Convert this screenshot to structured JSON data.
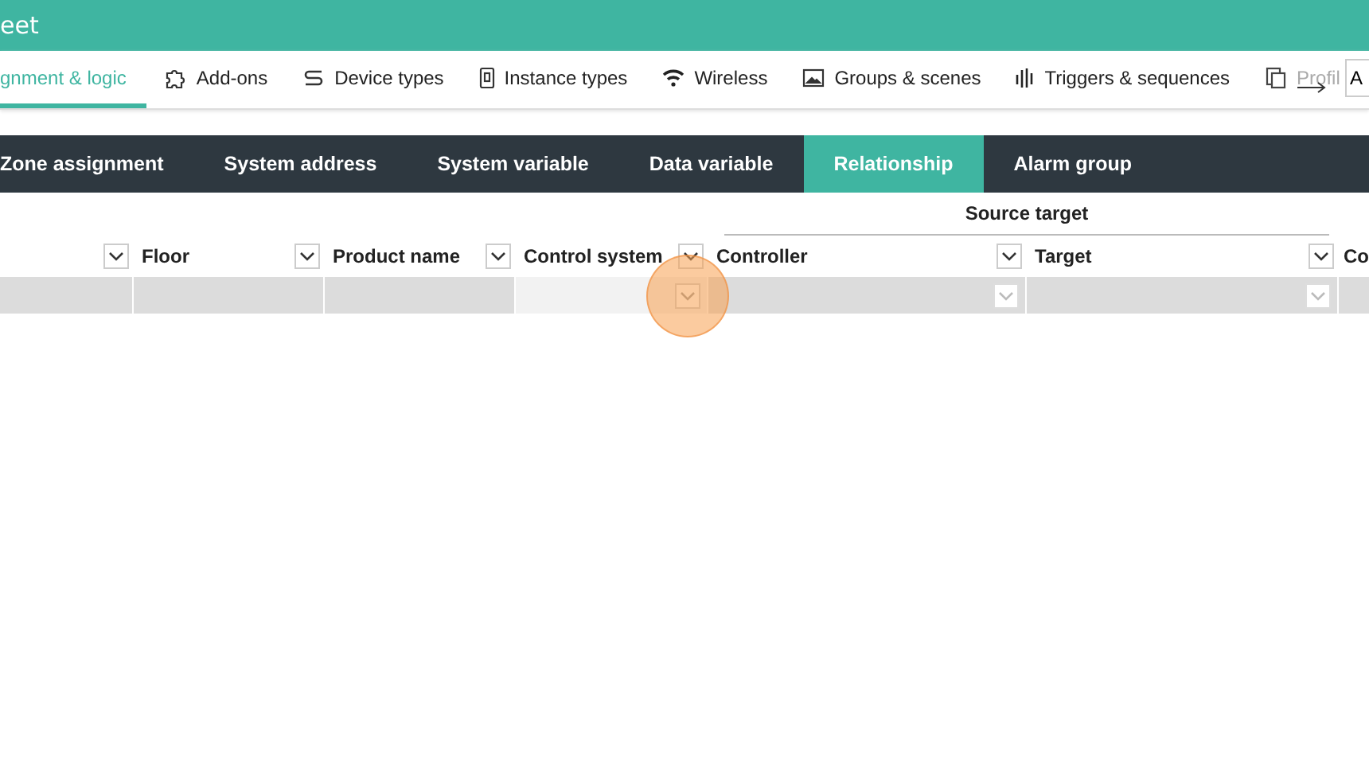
{
  "window": {
    "title": "eet"
  },
  "nav_tabs": [
    {
      "label": "gnment & logic",
      "selected": true,
      "kind": "plain"
    },
    {
      "label": "Add-ons",
      "selected": false,
      "kind": "puzzle"
    },
    {
      "label": "Device types",
      "selected": false,
      "kind": "device"
    },
    {
      "label": "Instance types",
      "selected": false,
      "kind": "phone"
    },
    {
      "label": "Wireless",
      "selected": false,
      "kind": "wifi"
    },
    {
      "label": "Groups & scenes",
      "selected": false,
      "kind": "picture"
    },
    {
      "label": "Triggers & sequences",
      "selected": false,
      "kind": "bars"
    },
    {
      "label": "Profil",
      "selected": false,
      "kind": "profile"
    }
  ],
  "nav_field": {
    "value": "A"
  },
  "sub_tabs": [
    {
      "label": "Zone assignment",
      "selected": false
    },
    {
      "label": "System address",
      "selected": false
    },
    {
      "label": "System variable",
      "selected": false
    },
    {
      "label": "Data variable",
      "selected": false
    },
    {
      "label": "Relationship",
      "selected": true
    },
    {
      "label": "Alarm group",
      "selected": false
    }
  ],
  "grid": {
    "column_groups": [
      {
        "label": "Source target"
      }
    ],
    "columns": [
      {
        "kind": "filtered"
      },
      {
        "label": "Floor",
        "kind": "filtered"
      },
      {
        "label": "Product name",
        "kind": "filtered"
      },
      {
        "label": "Control system",
        "kind": "filtered"
      },
      {
        "label": "Controller",
        "kind": "filtered"
      },
      {
        "label": "Target",
        "kind": "filtered"
      },
      {
        "label": "Co",
        "kind": "plain"
      }
    ],
    "rows": [
      {
        "cells": [
          {
            "kind": "plain"
          },
          {
            "kind": "plain"
          },
          {
            "kind": "plain"
          },
          {
            "kind": "dropdown-focused"
          },
          {
            "kind": "dropdown"
          },
          {
            "kind": "dropdown"
          },
          {
            "kind": "plain"
          }
        ]
      }
    ]
  }
}
